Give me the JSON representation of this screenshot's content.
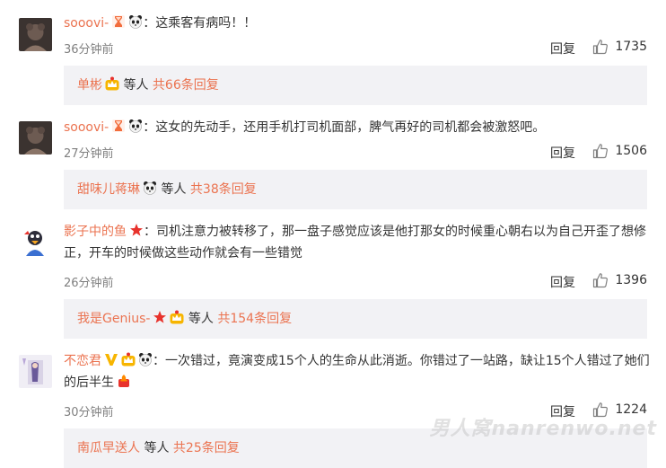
{
  "comments": [
    {
      "username": "sooovi-",
      "text": "：这乘客有病吗！！",
      "time": "36分钟前",
      "reply_label": "回复",
      "likes": "1735",
      "thread_user": "单彬",
      "thread_mid": " 等人 ",
      "thread_count": "共66条回复"
    },
    {
      "username": "sooovi-",
      "text": "：这女的先动手，还用手机打司机面部，脾气再好的司机都会被激怒吧。",
      "time": "27分钟前",
      "reply_label": "回复",
      "likes": "1506",
      "thread_user": "甜味儿蒋琳",
      "thread_mid": " 等人 ",
      "thread_count": "共38条回复"
    },
    {
      "username": "影子中的鱼",
      "text": "：司机注意力被转移了，那一盘子感觉应该是他打那女的时候重心朝右以为自己开歪了想修正，开车的时候做这些动作就会有一些错觉",
      "time": "26分钟前",
      "reply_label": "回复",
      "likes": "1396",
      "thread_user": "我是Genius-",
      "thread_mid": " 等人 ",
      "thread_count": "共154条回复"
    },
    {
      "username": "不恋君",
      "text": "：一次错过，竟演变成15个人的生命从此消逝。你错过了一站路，缺让15个人错过了她们的后半生",
      "time": "30分钟前",
      "reply_label": "回复",
      "likes": "1224",
      "thread_user": "南瓜早送人",
      "thread_mid": " 等人 ",
      "thread_count": "共25条回复"
    }
  ],
  "icons": {
    "like": "thumbs-up-icon",
    "hourglass": "hourglass-badge-icon",
    "panda": "panda-emoji-icon",
    "star": "red-star-badge-icon",
    "crown": "crown-badge-icon",
    "vip": "vip-v-badge-icon",
    "fire": "fire-emoji-icon"
  },
  "colors": {
    "username": "#eb7350",
    "thread_bg": "#f2f2f5",
    "time": "#808080"
  },
  "watermark": "男人窝nanrenwo.net"
}
